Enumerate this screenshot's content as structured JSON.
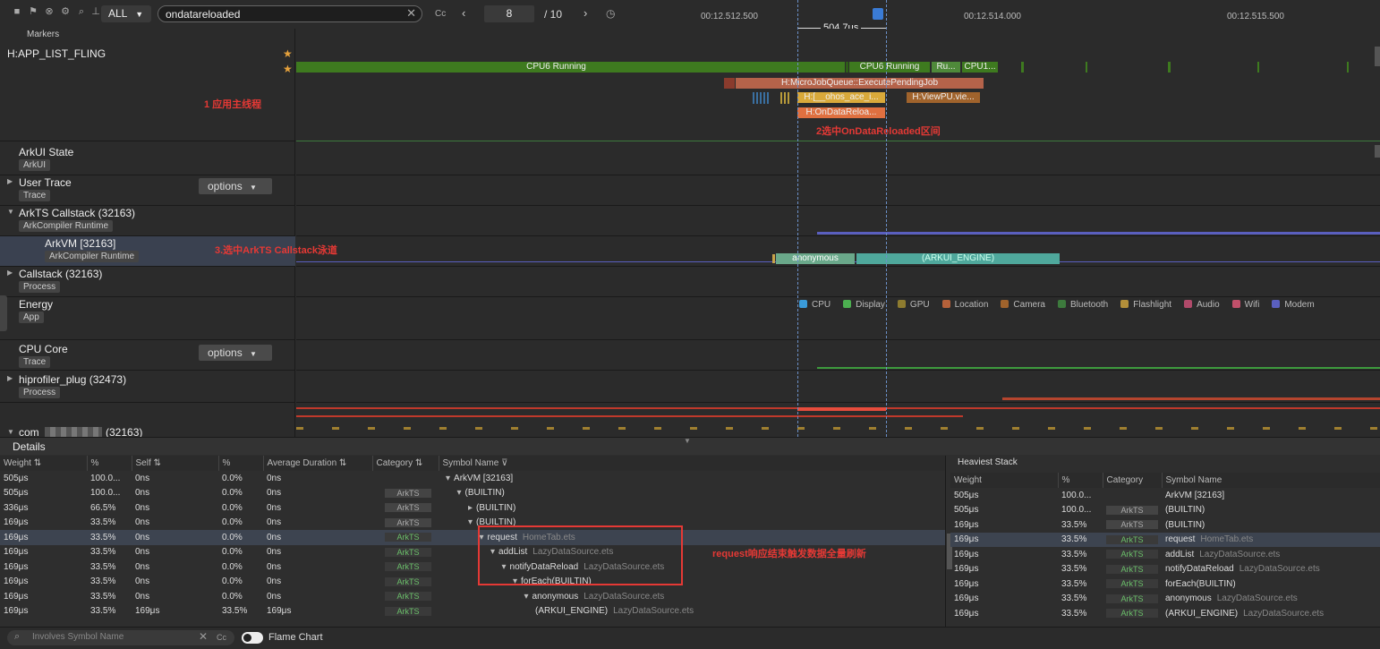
{
  "toolbar": {
    "filter": "ALL",
    "search_value": "ondatareloaded",
    "case_label": "Cc",
    "current_page": "8",
    "total_pages": "/ 10"
  },
  "timeline": {
    "ticks": [
      "00:12.512.500",
      "00:12.514.000",
      "00:12.515.500"
    ],
    "range_label": "504.7μs"
  },
  "tracks": {
    "markers": "Markers",
    "app_fling": "H:APP_LIST_FLING",
    "arkui_state": "ArkUI State",
    "arkui_tag": "ArkUI",
    "user_trace": "User Trace",
    "trace_tag": "Trace",
    "options": "options",
    "arkts_callstack": "ArkTS Callstack (32163)",
    "ark_runtime_tag": "ArkCompiler Runtime",
    "arkvm": "ArkVM [32163]",
    "callstack": "Callstack (32163)",
    "process_tag": "Process",
    "energy": "Energy",
    "app_tag": "App",
    "cpu_core": "CPU Core",
    "hiprofiler": "hiprofiler_plug (32473)",
    "com": "com",
    "com_pid": "(32163)"
  },
  "slices": {
    "cpu6_running_1": "CPU6 Running",
    "cpu6_running_2": "CPU6 Running",
    "ru": "Ru...",
    "cpu1": "CPU1...",
    "microjob": "H:MicroJobQueue::ExecutePendingJob",
    "ohos_ace": "H:[__ohos_ace_i...",
    "viewpu": "H:ViewPU.vie...",
    "ondatareload": "H:OnDataReloa...",
    "anonymous": "anonymous",
    "arkui_engine": "(ARKUI_ENGINE)"
  },
  "annotations": {
    "a1": "1 应用主线程",
    "a2": "2选中OnDataReloaded区间",
    "a3": "3.选中ArkTS Callstack泳道",
    "a4": "request响应结束触发数据全量刷新"
  },
  "legend": [
    {
      "label": "CPU",
      "color": "#3a9bd9"
    },
    {
      "label": "Display",
      "color": "#4caf50"
    },
    {
      "label": "GPU",
      "color": "#8d7b2f"
    },
    {
      "label": "Location",
      "color": "#b5613a"
    },
    {
      "label": "Camera",
      "color": "#a0632c"
    },
    {
      "label": "Bluetooth",
      "color": "#3d7a3d"
    },
    {
      "label": "Flashlight",
      "color": "#b38f3a"
    },
    {
      "label": "Audio",
      "color": "#b04a6a"
    },
    {
      "label": "Wifi",
      "color": "#c0506a"
    },
    {
      "label": "Modem",
      "color": "#5a5fbf"
    }
  ],
  "details": {
    "title": "Details",
    "headers": [
      "Weight ⇅",
      "%",
      "Self ⇅",
      "%",
      "Average Duration ⇅",
      "Category ⇅",
      "Symbol Name ⊽"
    ],
    "rows": [
      {
        "weight": "505μs",
        "pct": "100.0...",
        "self": "0ns",
        "spct": "0.0%",
        "avg": "0ns",
        "cat": "",
        "indent": 0,
        "arrow": "▾",
        "sym": "ArkVM [32163]",
        "file": ""
      },
      {
        "weight": "505μs",
        "pct": "100.0...",
        "self": "0ns",
        "spct": "0.0%",
        "avg": "0ns",
        "cat": "ArkTS",
        "indent": 1,
        "arrow": "▾",
        "sym": "(BUILTIN)",
        "file": ""
      },
      {
        "weight": "336μs",
        "pct": "66.5%",
        "self": "0ns",
        "spct": "0.0%",
        "avg": "0ns",
        "cat": "ArkTS",
        "indent": 2,
        "arrow": "▸",
        "sym": "(BUILTIN)",
        "file": ""
      },
      {
        "weight": "169μs",
        "pct": "33.5%",
        "self": "0ns",
        "spct": "0.0%",
        "avg": "0ns",
        "cat": "ArkTS",
        "indent": 2,
        "arrow": "▾",
        "sym": "(BUILTIN)",
        "file": ""
      },
      {
        "weight": "169μs",
        "pct": "33.5%",
        "self": "0ns",
        "spct": "0.0%",
        "avg": "0ns",
        "cat": "ArkTS",
        "indent": 3,
        "arrow": "▾",
        "sym": "request",
        "file": "HomeTab.ets"
      },
      {
        "weight": "169μs",
        "pct": "33.5%",
        "self": "0ns",
        "spct": "0.0%",
        "avg": "0ns",
        "cat": "ArkTS",
        "indent": 4,
        "arrow": "▾",
        "sym": "addList",
        "file": "LazyDataSource.ets"
      },
      {
        "weight": "169μs",
        "pct": "33.5%",
        "self": "0ns",
        "spct": "0.0%",
        "avg": "0ns",
        "cat": "ArkTS",
        "indent": 5,
        "arrow": "▾",
        "sym": "notifyDataReload",
        "file": "LazyDataSource.ets"
      },
      {
        "weight": "169μs",
        "pct": "33.5%",
        "self": "0ns",
        "spct": "0.0%",
        "avg": "0ns",
        "cat": "ArkTS",
        "indent": 6,
        "arrow": "▾",
        "sym": "forEach(BUILTIN)",
        "file": ""
      },
      {
        "weight": "169μs",
        "pct": "33.5%",
        "self": "0ns",
        "spct": "0.0%",
        "avg": "0ns",
        "cat": "ArkTS",
        "indent": 7,
        "arrow": "▾",
        "sym": "anonymous",
        "file": "LazyDataSource.ets"
      },
      {
        "weight": "169μs",
        "pct": "33.5%",
        "self": "169μs",
        "spct": "33.5%",
        "avg": "169μs",
        "cat": "ArkTS",
        "indent": 8,
        "arrow": "",
        "sym": "(ARKUI_ENGINE)",
        "file": "LazyDataSource.ets"
      }
    ]
  },
  "heaviest": {
    "title": "Heaviest Stack",
    "headers": [
      "Weight",
      "%",
      "Category",
      "Symbol Name"
    ],
    "rows": [
      {
        "weight": "505μs",
        "pct": "100.0...",
        "cat": "",
        "sym": "ArkVM [32163]",
        "file": ""
      },
      {
        "weight": "505μs",
        "pct": "100.0...",
        "cat": "ArkTS",
        "sym": "(BUILTIN)",
        "file": ""
      },
      {
        "weight": "169μs",
        "pct": "33.5%",
        "cat": "ArkTS",
        "sym": "(BUILTIN)",
        "file": ""
      },
      {
        "weight": "169μs",
        "pct": "33.5%",
        "cat": "ArkTS",
        "sym": "request",
        "file": "HomeTab.ets"
      },
      {
        "weight": "169μs",
        "pct": "33.5%",
        "cat": "ArkTS",
        "sym": "addList",
        "file": "LazyDataSource.ets"
      },
      {
        "weight": "169μs",
        "pct": "33.5%",
        "cat": "ArkTS",
        "sym": "notifyDataReload",
        "file": "LazyDataSource.ets"
      },
      {
        "weight": "169μs",
        "pct": "33.5%",
        "cat": "ArkTS",
        "sym": "forEach(BUILTIN)",
        "file": ""
      },
      {
        "weight": "169μs",
        "pct": "33.5%",
        "cat": "ArkTS",
        "sym": "anonymous",
        "file": "LazyDataSource.ets"
      },
      {
        "weight": "169μs",
        "pct": "33.5%",
        "cat": "ArkTS",
        "sym": "(ARKUI_ENGINE)",
        "file": "LazyDataSource.ets"
      }
    ]
  },
  "footer": {
    "filter_placeholder": "Involves Symbol Name",
    "case_label": "Cc",
    "flame_chart": "Flame Chart"
  }
}
